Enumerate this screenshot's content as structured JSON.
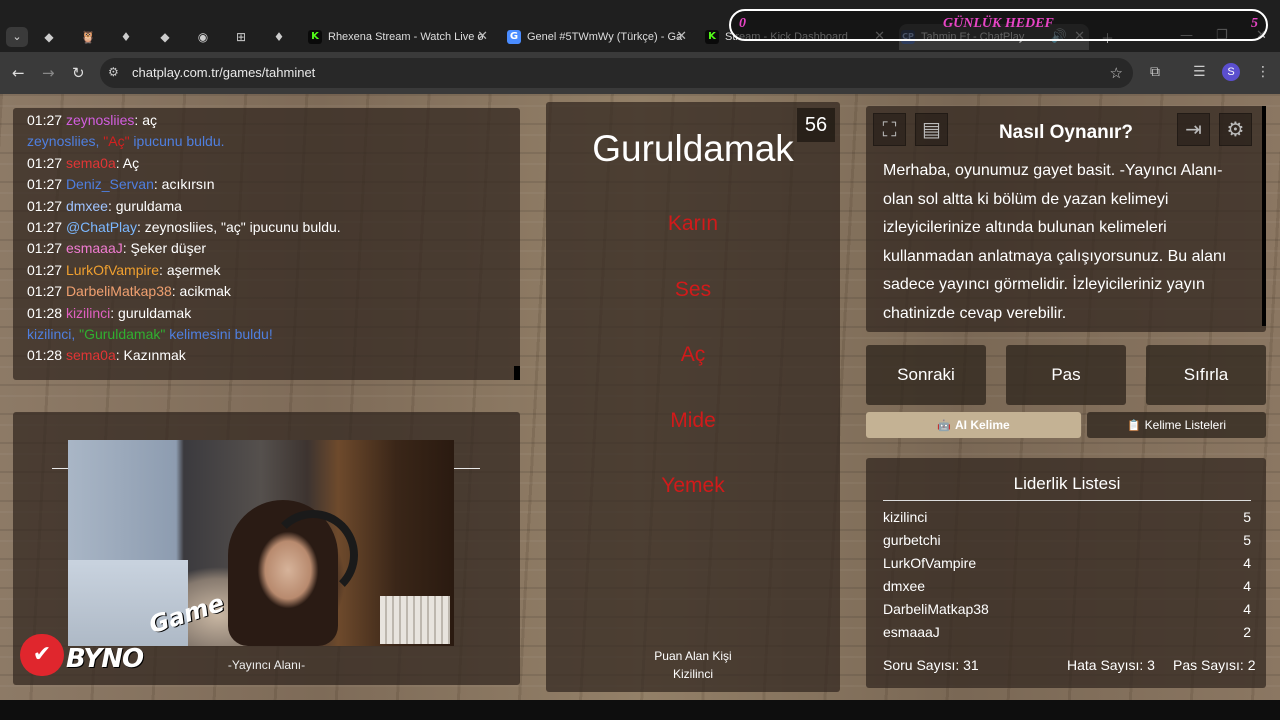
{
  "browser": {
    "tabs": [
      {
        "label": "Rhexena Stream - Watch Live o",
        "icon": "kick-icon",
        "color": "#53fc18"
      },
      {
        "label": "Genel #5TWmWy (Türkçe) - Ga",
        "icon": "game-icon",
        "color": "#4a8cff"
      },
      {
        "label": "Stream - Kick Dashboard",
        "icon": "kick-icon",
        "color": "#53fc18"
      },
      {
        "label": "Tahmin Et - ChatPlay",
        "icon": "chatplay-icon",
        "color": "#6a8cc7"
      }
    ],
    "mini_tabs": [
      "◆",
      "🦉",
      "♦",
      "◆",
      "◉",
      "⊞",
      "♦"
    ],
    "url": "chatplay.com.tr/games/tahminet",
    "avatar_letter": "S"
  },
  "goal_overlay": {
    "left": "0",
    "title": "GÜNLÜK HEDEF",
    "right": "5"
  },
  "chat": [
    {
      "time": "01:27",
      "user": "zeynosliies",
      "user_color": "#d35ee0",
      "msg": ": aç",
      "system": false
    },
    {
      "time": "",
      "user": "zeynosliies, ",
      "user_color": "#4f7fe0",
      "quote": "\"Aç\"",
      "quote_color": "#d42020",
      "msg": " ipucunu buldu.",
      "msg_color": "#4f7fe0",
      "system": true
    },
    {
      "time": "01:27",
      "user": "sema0a",
      "user_color": "#e03535",
      "msg": ": Aç",
      "system": false
    },
    {
      "time": "01:27",
      "user": "Deniz_Servan",
      "user_color": "#4f7fe0",
      "msg": ": acıkırsın",
      "system": false
    },
    {
      "time": "01:27",
      "user": "dmxee",
      "user_color": "#9fc4ff",
      "msg": ": guruldama",
      "system": false
    },
    {
      "time": "01:27",
      "user": "@ChatPlay",
      "user_color": "#7cb8ff",
      "msg": ": zeynosliies, \"aç\" ipucunu buldu.",
      "system": false
    },
    {
      "time": "01:27",
      "user": "esmaaaJ",
      "user_color": "#f07bd1",
      "msg": ": Şeker düşer",
      "system": false
    },
    {
      "time": "01:27",
      "user": "LurkOfVampire",
      "user_color": "#f0a030",
      "msg": ": aşermek",
      "system": false
    },
    {
      "time": "01:27",
      "user": "DarbeliMatkap38",
      "user_color": "#f0a070",
      "msg": ": acikmak",
      "system": false
    },
    {
      "time": "01:28",
      "user": "kizilinci",
      "user_color": "#e060c0",
      "msg": ": guruldamak",
      "system": false
    },
    {
      "time": "",
      "user": "kizilinci, ",
      "user_color": "#4f7fe0",
      "quote": "\"Guruldamak\"",
      "quote_color": "#30b030",
      "msg": " kelimesini buldu!",
      "msg_color": "#4f7fe0",
      "system": true
    },
    {
      "time": "01:28",
      "user": "sema0a",
      "user_color": "#e03535",
      "msg": ": Kazınmak",
      "system": false
    }
  ],
  "stream": {
    "label": "-Yayıncı Alanı-",
    "logo_text": "BYNO",
    "logo_game": "Game"
  },
  "game": {
    "timer": "56",
    "word": "Guruldamak",
    "taboo": [
      "Karın",
      "Ses",
      "Aç",
      "Mide",
      "Yemek"
    ],
    "scorer_label": "Puan Alan Kişi",
    "scorer_name": "Kizilinci"
  },
  "howto": {
    "title": "Nasıl Oynanır?",
    "text": "Merhaba, oyunumuz gayet basit. -Yayıncı Alanı- olan sol altta ki bölüm de yazan kelimeyi izleyicilerinize altında bulunan kelimeleri kullanmadan anlatmaya çalışıyorsunuz. Bu alanı sadece yayıncı görmelidir. İzleyicileriniz yayın chatinizde cevap verebilir."
  },
  "actions": {
    "next": "Sonraki",
    "pass": "Pas",
    "reset": "Sıfırla",
    "ai": "AI Kelime",
    "lists": "Kelime Listeleri"
  },
  "leaderboard": {
    "title": "Liderlik Listesi",
    "rows": [
      {
        "name": "kizilinci",
        "score": "5"
      },
      {
        "name": "gurbetchi",
        "score": "5"
      },
      {
        "name": "LurkOfVampire",
        "score": "4"
      },
      {
        "name": "dmxee",
        "score": "4"
      },
      {
        "name": "DarbeliMatkap38",
        "score": "4"
      },
      {
        "name": "esmaaaJ",
        "score": "2"
      }
    ],
    "questions": "Soru Sayısı: 31",
    "errors": "Hata Sayısı: 3",
    "passes": "Pas Sayısı: 2"
  }
}
